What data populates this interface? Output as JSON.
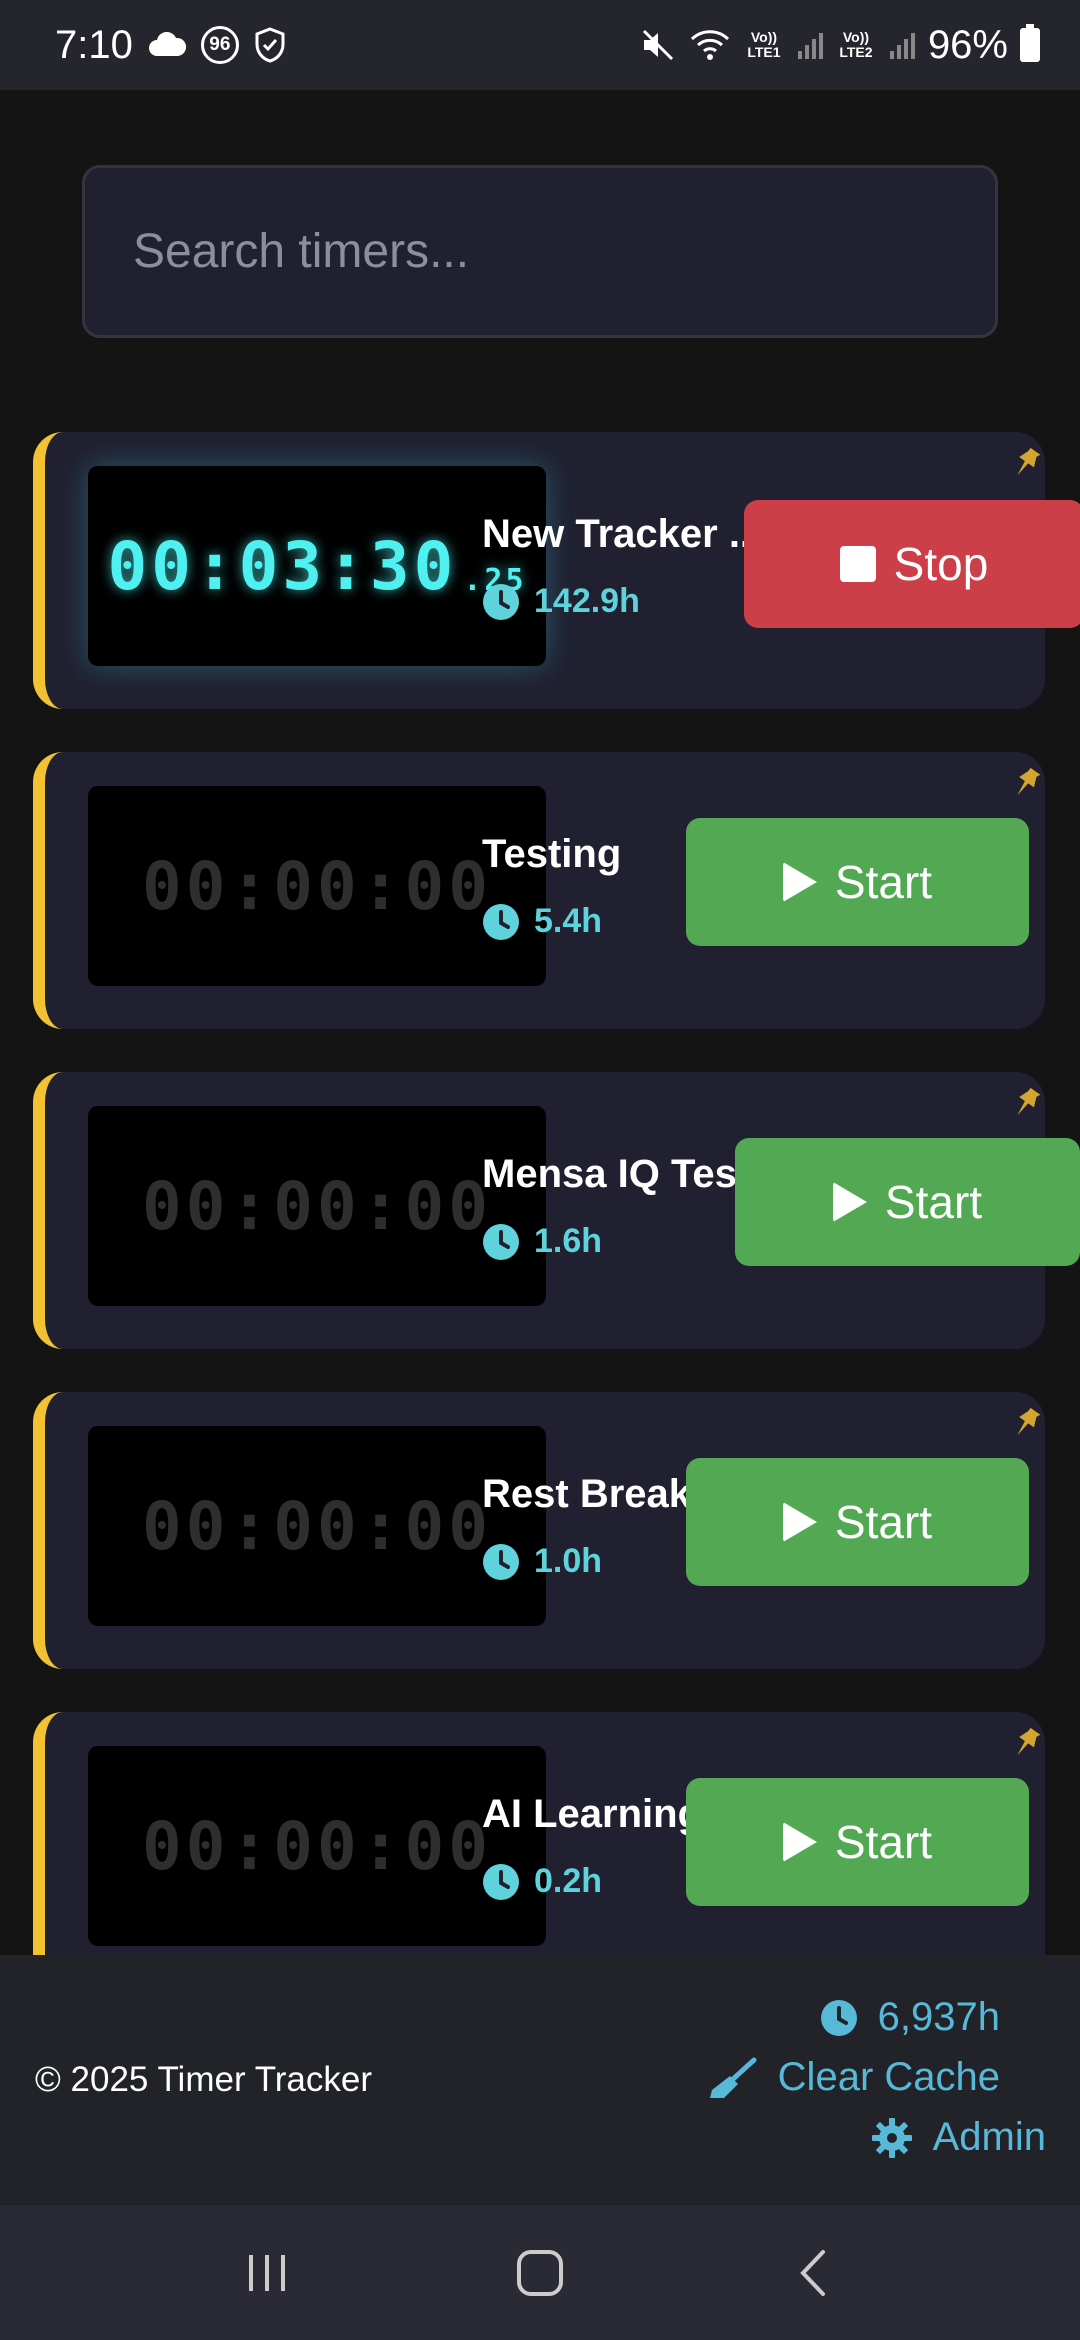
{
  "status_bar": {
    "time": "7:10",
    "notif_badge": "96",
    "lte1": "Vo)) LTE1",
    "lte2": "Vo)) LTE2",
    "battery": "96%"
  },
  "search": {
    "placeholder": "Search timers..."
  },
  "timers": [
    {
      "name": "New Tracker ...",
      "hours": "142.9h",
      "display": "00:03:30",
      "ms": ".25",
      "action": "Stop",
      "active": true
    },
    {
      "name": "Testing",
      "hours": "5.4h",
      "display": "00:00:00",
      "action": "Start",
      "active": false
    },
    {
      "name": "Mensa IQ Test",
      "hours": "1.6h",
      "display": "00:00:00",
      "action": "Start",
      "active": false
    },
    {
      "name": "Rest Break",
      "hours": "1.0h",
      "display": "00:00:00",
      "action": "Start",
      "active": false
    },
    {
      "name": "AI Learning",
      "hours": "0.2h",
      "display": "00:00:00",
      "action": "Start",
      "active": false
    }
  ],
  "footer": {
    "copyright": "© 2025 Timer Tracker",
    "total_hours": "6,937h",
    "clear_cache": "Clear Cache",
    "admin": "Admin"
  },
  "colors": {
    "accent_cyan": "#5fd3dc",
    "start_green": "#52a853",
    "stop_red": "#cc3e48",
    "pin_gold": "#d4a630",
    "card_border": "#f1c232"
  }
}
